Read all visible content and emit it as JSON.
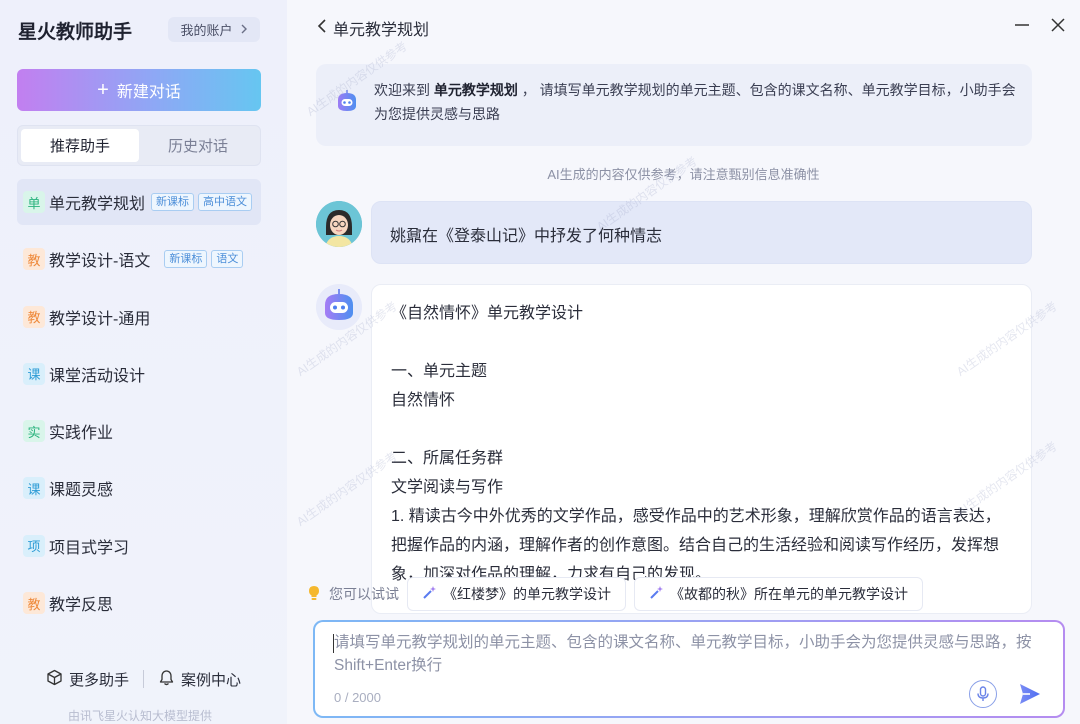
{
  "sidebar": {
    "app_title": "星火教师助手",
    "account_label": "我的账户",
    "new_chat_label": "新建对话",
    "tabs": [
      {
        "label": "推荐助手",
        "active": true
      },
      {
        "label": "历史对话",
        "active": false
      }
    ],
    "items": [
      {
        "badge": "单",
        "label": "单元教学规划",
        "tags": [
          "新课标",
          "高中语文"
        ],
        "active": true
      },
      {
        "badge": "教",
        "label": "教学设计-语文",
        "tags": [
          "新课标",
          "语文"
        ]
      },
      {
        "badge": "教",
        "label": "教学设计-通用",
        "tags": []
      },
      {
        "badge": "课",
        "label": "课堂活动设计",
        "tags": []
      },
      {
        "badge": "实",
        "label": "实践作业",
        "tags": []
      },
      {
        "badge": "课",
        "label": "课题灵感",
        "tags": []
      },
      {
        "badge": "项",
        "label": "项目式学习",
        "tags": []
      },
      {
        "badge": "教",
        "label": "教学反思",
        "tags": []
      }
    ],
    "footer": {
      "more_assistants": "更多助手",
      "case_center": "案例中心",
      "powered_by": "由讯飞星火认知大模型提供"
    }
  },
  "main": {
    "title": "单元教学规划",
    "welcome": {
      "prefix": "欢迎来到",
      "name": "单元教学规划",
      "suffix": "， 请填写单元教学规划的单元主题、包含的课文名称、单元教学目标，小助手会为您提供灵感与思路"
    },
    "disclaimer": "AI生成的内容仅供参考，请注意甄别信息准确性",
    "user_message": "姚鼐在《登泰山记》中抒发了何种情志",
    "bot_lines": [
      "《自然情怀》单元教学设计",
      "",
      "一、单元主题",
      "自然情怀",
      "",
      "二、所属任务群",
      "文学阅读与写作",
      "1. 精读古今中外优秀的文学作品，感受作品中的艺术形象，理解欣赏作品的语言表达，",
      "把握作品的内涵，理解作者的创作意图。结合自己的生活经验和阅读写作经历，发挥想",
      "象，加深对作品的理解，力求有自己的发现。"
    ],
    "try": {
      "label": "您可以试试",
      "suggestions": [
        "《红楼梦》的单元教学设计",
        "《故都的秋》所在单元的单元教学设计"
      ]
    },
    "input": {
      "placeholder": "请填写单元教学规划的单元主题、包含的课文名称、单元教学目标，小助手会为您提供灵感与思路，按Shift+Enter换行",
      "counter": "0 / 2000"
    },
    "watermark": "AI生成的内容仅供参考"
  },
  "colors": {
    "accent": "#5b7cf0",
    "brand_gradient": [
      "#c27ff0",
      "#66c6f1"
    ]
  }
}
